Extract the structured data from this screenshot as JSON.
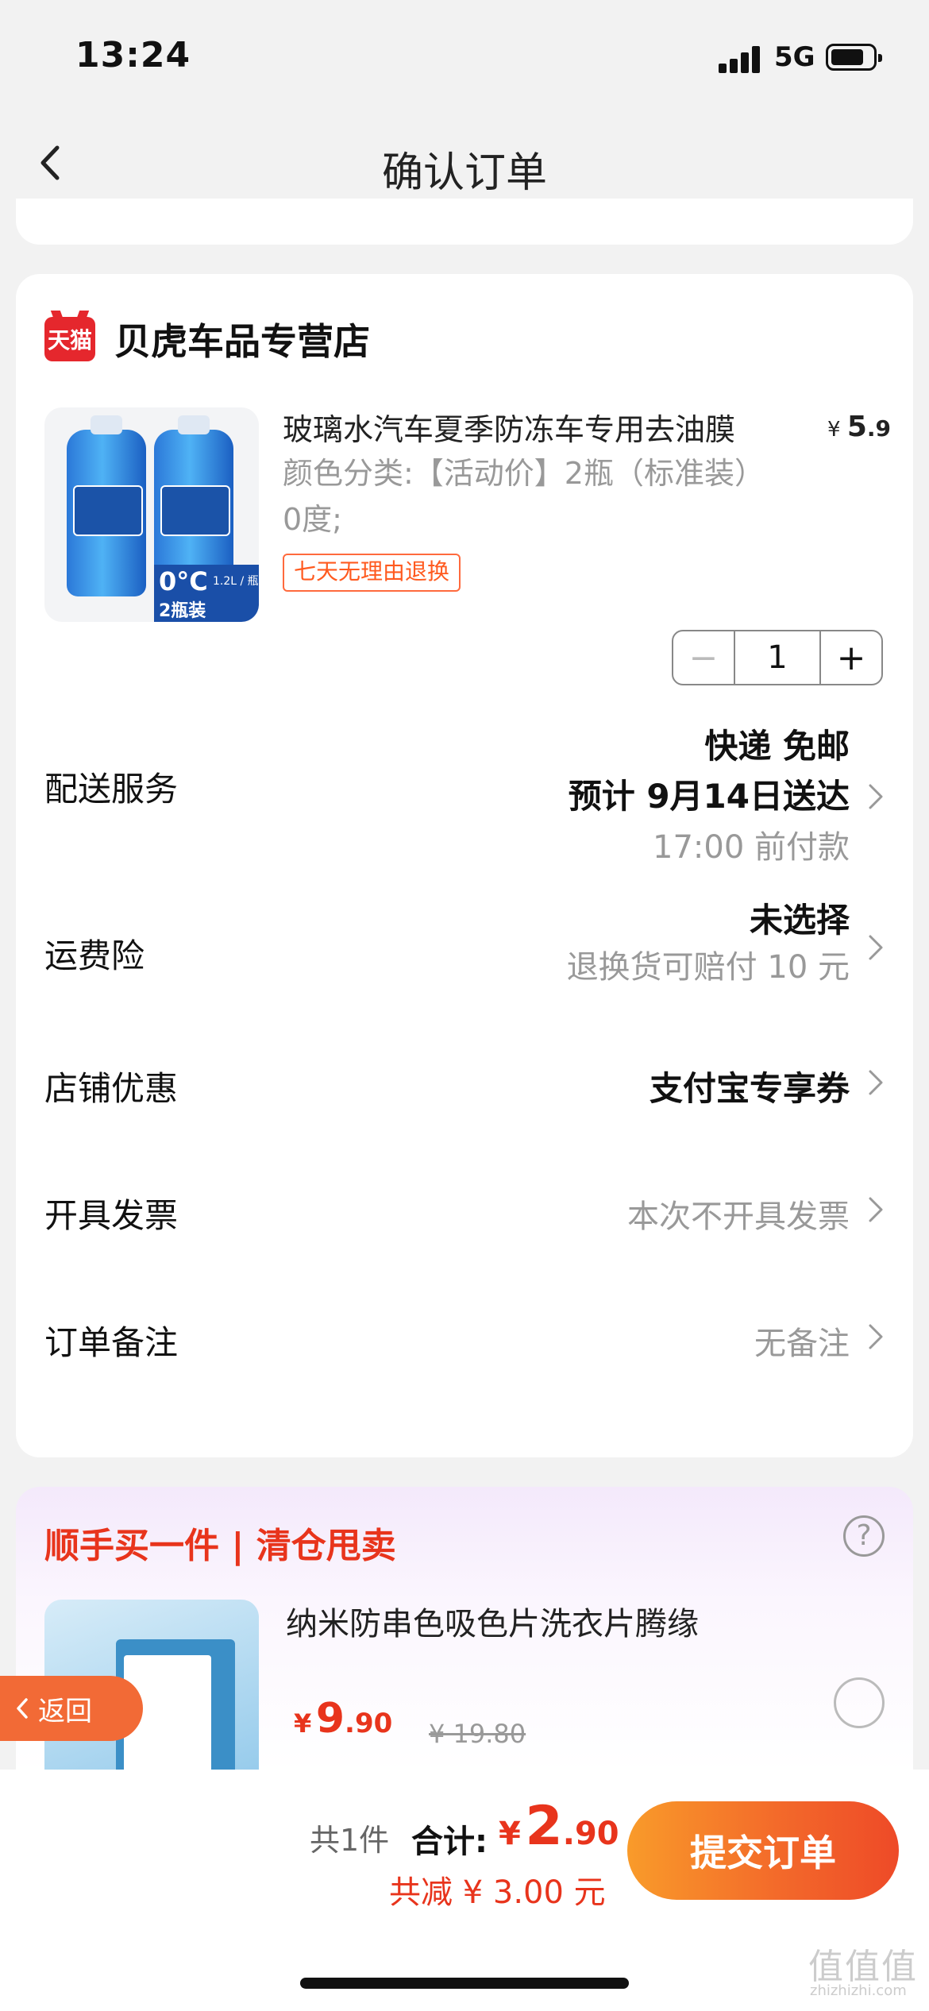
{
  "status_bar": {
    "time": "13:24",
    "network": "5G"
  },
  "nav": {
    "title": "确认订单"
  },
  "shop": {
    "badge": "天猫",
    "name": "贝虎车品专营店"
  },
  "product": {
    "title": "玻璃水汽车夏季防冻车专用去油膜",
    "spec": "颜色分类:【活动价】2瓶（标准装）0度;",
    "price_symbol": "¥",
    "price_int": "5",
    "price_dec": ".9",
    "tag": "七天无理由退换",
    "quantity": "1",
    "image_badge": {
      "line1": "0°C",
      "line2": "2瓶装",
      "line3": "1.2L / 瓶"
    }
  },
  "rows": {
    "delivery": {
      "label": "配送服务",
      "line1": "快递 免邮",
      "line2": "预计 9月14日送达",
      "line3": "17:00 前付款"
    },
    "insurance": {
      "label": "运费险",
      "line1": "未选择",
      "line2": "退换货可赔付 10 元"
    },
    "discount": {
      "label": "店铺优惠",
      "value": "支付宝专享券"
    },
    "invoice": {
      "label": "开具发票",
      "value": "本次不开具发票"
    },
    "remark": {
      "label": "订单备注",
      "value": "无备注"
    }
  },
  "upsell": {
    "title": "顺手买一件 | 清仓甩卖",
    "help_icon": "?",
    "item_name": "纳米防串色吸色片洗衣片腾缘",
    "price_symbol": "¥",
    "price_int": "9",
    "price_dec": ".90",
    "orig_price": "¥ 19.80"
  },
  "back_pill": {
    "label": "返回"
  },
  "footer": {
    "count": "共1件",
    "total_label": "合计:",
    "total_symbol": "¥",
    "total_int": "2",
    "total_dec": ".90",
    "saved": "共减 ¥ 3.00 元",
    "submit": "提交订单"
  },
  "watermark": {
    "cn": "值值值",
    "en": "zhizhizhi.com"
  },
  "colors": {
    "accent": "#e8341c",
    "button": "#f36a2a",
    "tmall": "#e5272d"
  }
}
